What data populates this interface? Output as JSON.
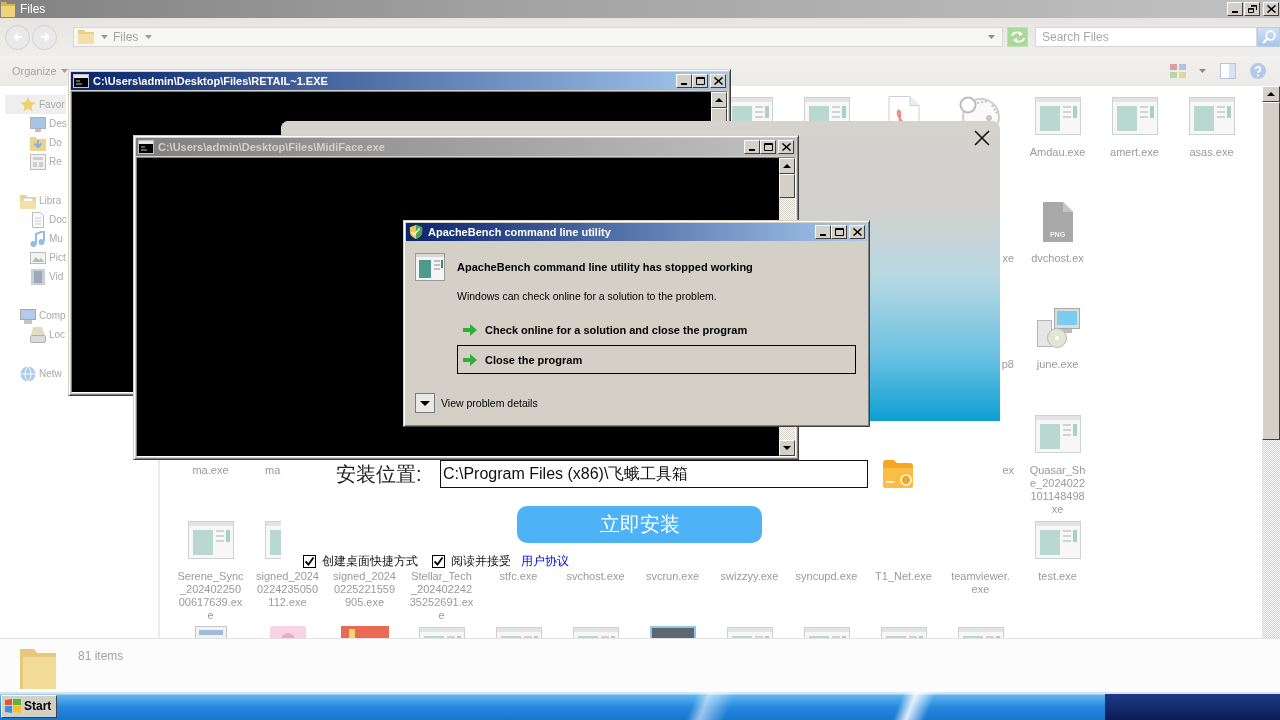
{
  "explorer": {
    "title": "Files",
    "breadcrumb": [
      "Files"
    ],
    "search": {
      "placeholder": "Search Files"
    },
    "toolbar": {
      "organize": "Organize"
    },
    "nav": [
      {
        "label": "Favor",
        "kind": "favorites",
        "selected": true,
        "children": [
          {
            "label": "Des",
            "kind": "desktop",
            "selected": false
          },
          {
            "label": "Do",
            "kind": "downloads",
            "selected": false
          },
          {
            "label": "Re",
            "kind": "recent",
            "selected": false
          }
        ]
      },
      {
        "label": "Libra",
        "kind": "libraries",
        "selected": false,
        "children": [
          {
            "label": "Doc",
            "kind": "documents",
            "selected": false
          },
          {
            "label": "Mu",
            "kind": "music",
            "selected": false
          },
          {
            "label": "Pict",
            "kind": "pictures",
            "selected": false
          },
          {
            "label": "Vid",
            "kind": "videos",
            "selected": false
          }
        ]
      },
      {
        "label": "Comp",
        "kind": "computer",
        "selected": false,
        "children": [
          {
            "label": "Loc",
            "kind": "disk",
            "selected": false
          }
        ]
      },
      {
        "label": "Netw",
        "kind": "network",
        "selected": false
      }
    ],
    "files": [
      [
        {
          "kind": "app"
        },
        {
          "kind": "app"
        },
        {
          "kind": "pdf"
        },
        {
          "kind": "diagram"
        },
        {
          "kind": "app",
          "label": [
            "Amdau.exe"
          ]
        },
        {
          "kind": "app",
          "label": [
            "amert.exe"
          ]
        },
        {
          "kind": "app",
          "label": [
            "asas.exe"
          ]
        }
      ],
      [
        {
          "label": [
            "xe"
          ]
        },
        {
          "kind": "png",
          "badge": "PNG",
          "label": [
            "dvchost.ex"
          ]
        }
      ],
      [
        {
          "label": [
            "p8"
          ]
        },
        {
          "kind": "setup",
          "label": [
            "june.exe"
          ]
        }
      ],
      [
        {
          "label": [
            "ma.exe"
          ]
        },
        {
          "label": [
            "ma"
          ]
        },
        {
          "label": [
            "ex"
          ]
        },
        {
          "kind": "app",
          "label": [
            "Quasar_Sh",
            "e_2024022",
            "101148498",
            "xe"
          ]
        }
      ],
      [
        {
          "kind": "app",
          "label": [
            "Serene_Sync",
            "_202402250",
            "00617639.ex",
            "e"
          ]
        },
        {
          "kind": "app",
          "label": [
            "signed_2024",
            "0224235050",
            "112.exe"
          ]
        },
        {
          "label": [
            "signed_2024",
            "0225221559",
            "905.exe"
          ]
        },
        {
          "label": [
            "Stellar_Tech",
            "_202402242",
            "35252691.ex",
            "e"
          ]
        },
        {
          "label": [
            "stfc.exe"
          ]
        },
        {
          "label": [
            "svchost.exe"
          ]
        },
        {
          "label": [
            "svcrun.exe"
          ]
        },
        {
          "label": [
            "swizzyy.exe"
          ]
        },
        {
          "label": [
            "syncupd.exe"
          ]
        },
        {
          "label": [
            "T1_Net.exe"
          ]
        },
        {
          "label": [
            "teamviewer.",
            "exe"
          ]
        },
        {
          "kind": "app",
          "label": [
            "test.exe"
          ]
        }
      ],
      [
        {
          "kind": "document"
        },
        {
          "kind": "media"
        },
        {
          "kind": "picture"
        },
        {
          "kind": "app"
        },
        {
          "kind": "app"
        },
        {
          "kind": "app"
        },
        {
          "kind": "photo"
        },
        {
          "kind": "app"
        },
        {
          "kind": "app"
        },
        {
          "kind": "app"
        },
        {
          "kind": "app"
        }
      ]
    ],
    "status": "81 items"
  },
  "windows": [
    {
      "kind": "console",
      "title": "C:\\Users\\admin\\Desktop\\Files\\RETAIL~1.EXE",
      "active": true
    },
    {
      "kind": "installer",
      "location_label": "安装位置:",
      "path": "C:\\Program Files (x86)\\飞蛾工具箱",
      "install_button": "立即安装",
      "options": [
        {
          "label": "创建桌面快捷方式",
          "checked": true
        },
        {
          "label": "阅读并接受",
          "checked": true,
          "link": "用户协议"
        }
      ]
    },
    {
      "kind": "console",
      "title": "C:\\Users\\admin\\Desktop\\Files\\MidiFace.exe",
      "active": false
    },
    {
      "kind": "error_dialog",
      "title": "ApacheBench command line utility",
      "active": true,
      "heading": "ApacheBench command line utility has stopped working",
      "message": "Windows can check online for a solution to the problem.",
      "actions": [
        {
          "label": "Check online for a solution and close the program",
          "selected": false
        },
        {
          "label": "Close the program",
          "selected": true
        }
      ],
      "details": "View problem details"
    }
  ],
  "taskbar": {
    "start": "Start"
  }
}
